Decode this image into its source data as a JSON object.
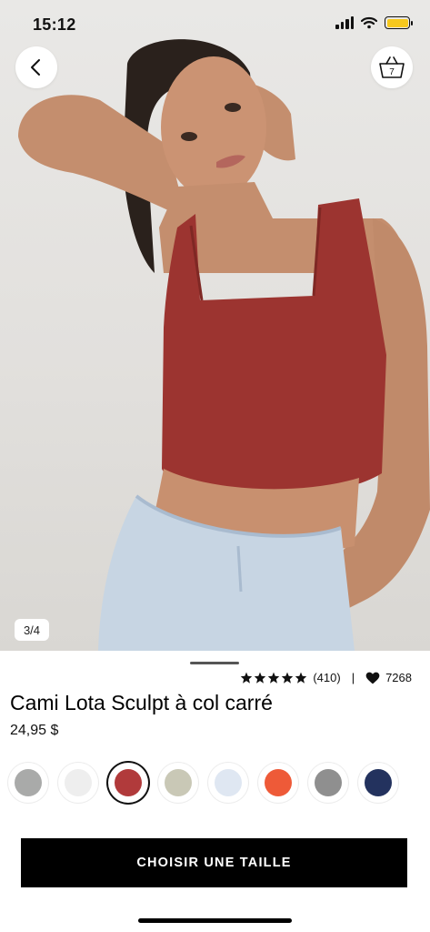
{
  "status_bar": {
    "time": "15:12",
    "battery_color": "#f6c81d"
  },
  "header": {
    "back_icon": "chevron-left-icon",
    "bag_icon": "shopping-basket-icon",
    "bag_count": "7"
  },
  "gallery": {
    "pager": "3/4"
  },
  "product": {
    "rating_stars": 5,
    "reviews": "(410)",
    "separator": "|",
    "favorites": "7268",
    "title": "Cami Lota Sculpt à col carré",
    "price": "24,95 $"
  },
  "swatches": [
    {
      "color": "#a9aaa9",
      "selected": false
    },
    {
      "color": "#eeeeee",
      "selected": false
    },
    {
      "color": "#b13a3b",
      "selected": true
    },
    {
      "color": "#c9c8b6",
      "selected": false
    },
    {
      "color": "#dfe7f2",
      "selected": false
    },
    {
      "color": "#ee5a38",
      "selected": false
    },
    {
      "color": "#8f8f8f",
      "selected": false
    },
    {
      "color": "#23325e",
      "selected": false
    }
  ],
  "cta": {
    "label": "CHOISIR UNE TAILLE"
  }
}
